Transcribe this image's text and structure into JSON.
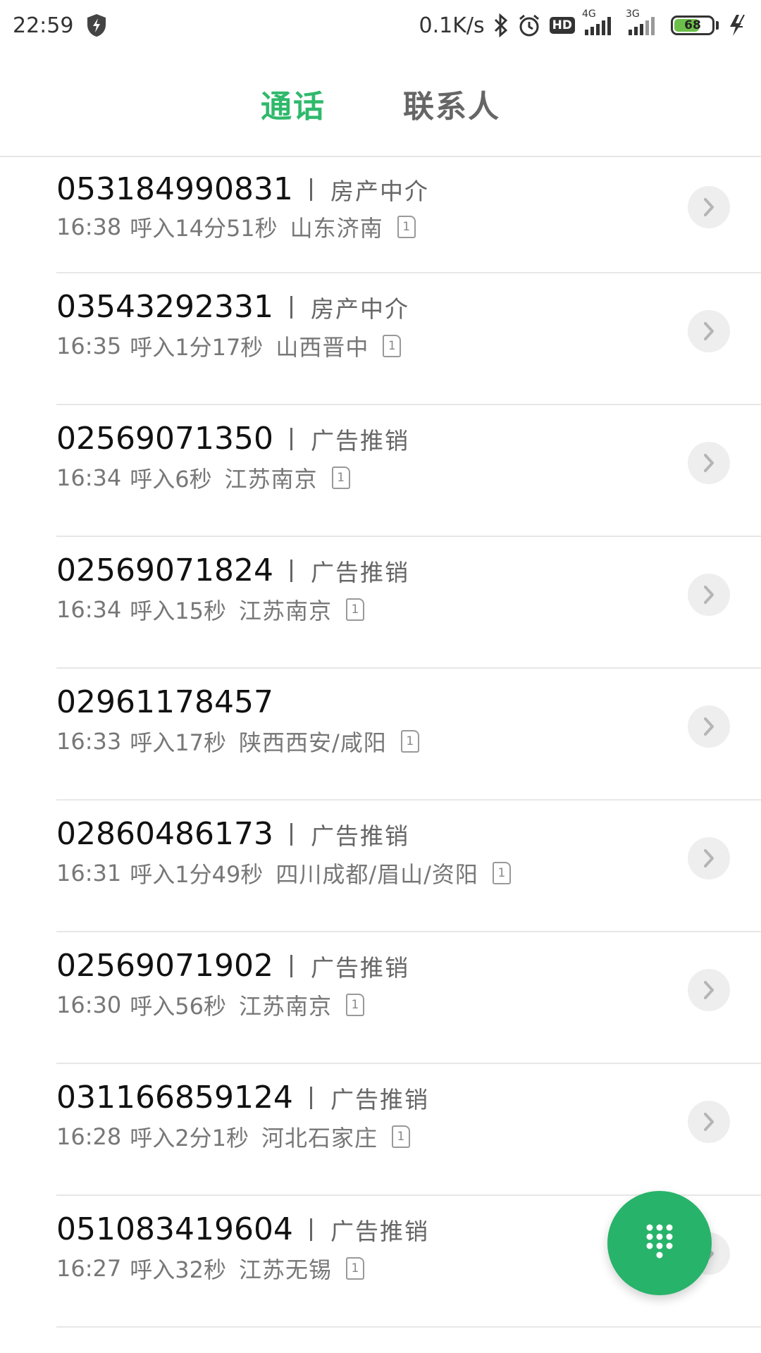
{
  "status_bar": {
    "time": "22:59",
    "speed": "0.1K/s",
    "hd": "HD",
    "net1": "4G",
    "net2": "3G",
    "battery_level": "68",
    "battery_fraction": 0.68,
    "battery_color": "#6cc04a"
  },
  "tabs": [
    {
      "label": "通话",
      "active": true
    },
    {
      "label": "联系人",
      "active": false
    }
  ],
  "calls": [
    {
      "number": "053184990831",
      "tag": "房产中介",
      "time": "16:38",
      "direction_duration": "呼入14分51秒",
      "location": "山东济南",
      "sim": "1"
    },
    {
      "number": "03543292331",
      "tag": "房产中介",
      "time": "16:35",
      "direction_duration": "呼入1分17秒",
      "location": "山西晋中",
      "sim": "1"
    },
    {
      "number": "02569071350",
      "tag": "广告推销",
      "time": "16:34",
      "direction_duration": "呼入6秒",
      "location": "江苏南京",
      "sim": "1"
    },
    {
      "number": "02569071824",
      "tag": "广告推销",
      "time": "16:34",
      "direction_duration": "呼入15秒",
      "location": "江苏南京",
      "sim": "1"
    },
    {
      "number": "02961178457",
      "tag": "",
      "time": "16:33",
      "direction_duration": "呼入17秒",
      "location": "陕西西安/咸阳",
      "sim": "1"
    },
    {
      "number": "02860486173",
      "tag": "广告推销",
      "time": "16:31",
      "direction_duration": "呼入1分49秒",
      "location": "四川成都/眉山/资阳",
      "sim": "1"
    },
    {
      "number": "02569071902",
      "tag": "广告推销",
      "time": "16:30",
      "direction_duration": "呼入56秒",
      "location": "江苏南京",
      "sim": "1"
    },
    {
      "number": "031166859124",
      "tag": "广告推销",
      "time": "16:28",
      "direction_duration": "呼入2分1秒",
      "location": "河北石家庄",
      "sim": "1"
    },
    {
      "number": "051083419604",
      "tag": "广告推销",
      "time": "16:27",
      "direction_duration": "呼入32秒",
      "location": "江苏无锡",
      "sim": "1"
    }
  ],
  "colors": {
    "accent": "#2fb96b",
    "fab": "#27b36a"
  },
  "icons": {
    "security": "shield-bolt-icon",
    "bluetooth": "bluetooth-icon",
    "alarm": "alarm-clock-icon",
    "signal": "signal-bars-icon",
    "charging": "charging-bolt-icon",
    "detail": "chevron-right-icon",
    "dialpad": "dialpad-icon"
  }
}
